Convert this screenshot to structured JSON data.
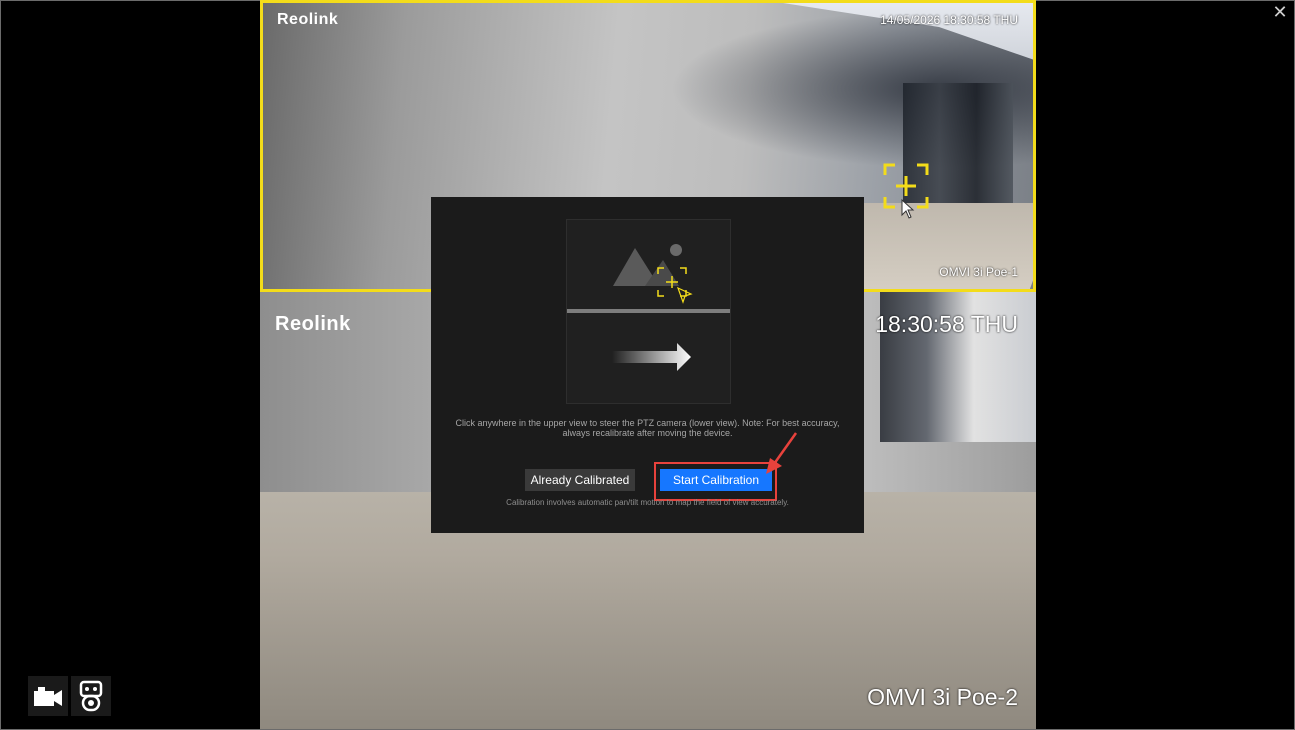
{
  "window": {
    "close_label": "✕"
  },
  "feeds": {
    "top": {
      "logo": "Reolink",
      "timestamp": "14/05/2026 18:30:58 THU",
      "camera_name": "OMVI 3i Poe-1"
    },
    "bottom": {
      "logo": "Reolink",
      "timestamp": "18:30:58 THU",
      "camera_name": "OMVI 3i Poe-2"
    },
    "selection_color": "#f3dc1a"
  },
  "dialog": {
    "hint": "Click anywhere in the upper view to steer the PTZ camera (lower view). Note: For best accuracy, always recalibrate after moving the device.",
    "already_calibrated_label": "Already Calibrated",
    "start_calibration_label": "Start Calibration",
    "footnote": "Calibration involves automatic pan/tilt motion to map the field of view accurately.",
    "primary_color": "#1677ff",
    "annotation_color": "#e8423c"
  },
  "toolbar": {
    "items": [
      {
        "icon": "video-camera-icon"
      },
      {
        "icon": "ptz-camera-icon"
      }
    ]
  }
}
